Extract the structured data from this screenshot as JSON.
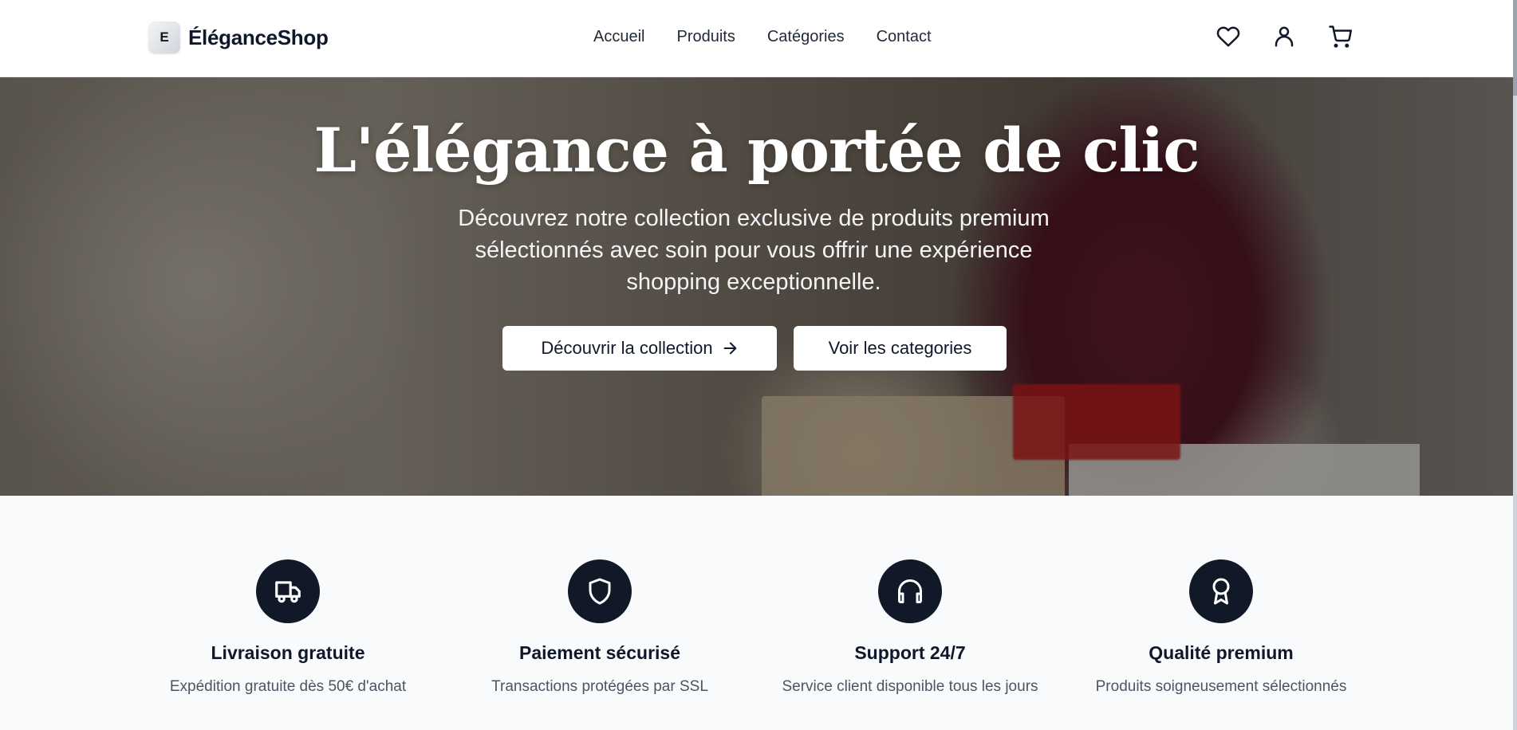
{
  "header": {
    "logo_badge": "E",
    "logo_text": "ÉléganceShop",
    "nav": [
      "Accueil",
      "Produits",
      "Catégories",
      "Contact"
    ],
    "icons": [
      "heart-icon",
      "user-icon",
      "cart-icon"
    ]
  },
  "hero": {
    "title": "L'élégance à portée de clic",
    "subtitle": "Découvrez notre collection exclusive de produits premium sélectionnés avec soin pour vous offrir une expérience shopping exceptionnelle.",
    "primary_button": "Découvrir la collection",
    "secondary_button": "Voir les categories"
  },
  "features": [
    {
      "icon": "truck-icon",
      "title": "Livraison gratuite",
      "desc": "Expédition gratuite dès 50€ d'achat"
    },
    {
      "icon": "shield-icon",
      "title": "Paiement sécurisé",
      "desc": "Transactions protégées par SSL"
    },
    {
      "icon": "headphones-icon",
      "title": "Support 24/7",
      "desc": "Service client disponible tous les jours"
    },
    {
      "icon": "award-icon",
      "title": "Qualité premium",
      "desc": "Produits soigneusement sélectionnés"
    }
  ],
  "colors": {
    "primary": "#111827",
    "background_alt": "#f8fafc",
    "text_muted": "#4b5563"
  }
}
